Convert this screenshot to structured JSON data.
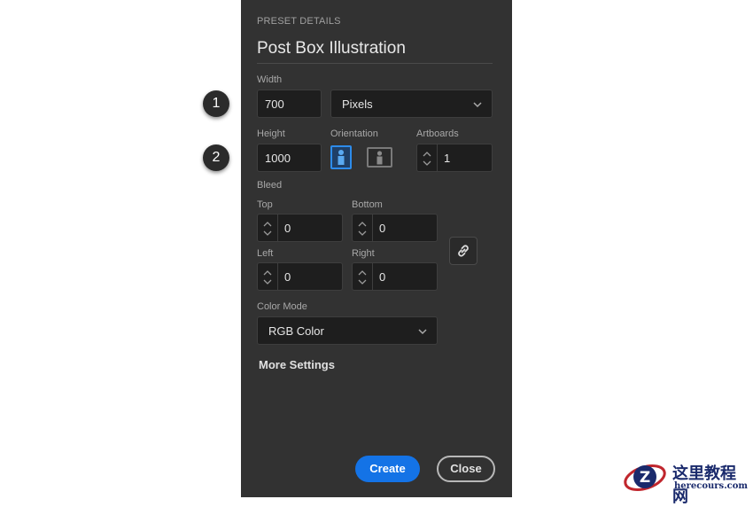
{
  "steps": [
    "1",
    "2"
  ],
  "panel": {
    "section_title": "PRESET DETAILS",
    "preset_name": "Post Box Illustration",
    "width": {
      "label": "Width",
      "value": "700",
      "unit": "Pixels"
    },
    "height": {
      "label": "Height",
      "value": "1000"
    },
    "orientation": {
      "label": "Orientation",
      "selected": "portrait"
    },
    "artboards": {
      "label": "Artboards",
      "value": "1"
    },
    "bleed": {
      "label": "Bleed",
      "top": {
        "label": "Top",
        "value": "0"
      },
      "bottom": {
        "label": "Bottom",
        "value": "0"
      },
      "left": {
        "label": "Left",
        "value": "0"
      },
      "right": {
        "label": "Right",
        "value": "0"
      }
    },
    "color_mode": {
      "label": "Color Mode",
      "value": "RGB Color"
    },
    "more_settings": "More Settings",
    "buttons": {
      "create": "Create",
      "close": "Close"
    }
  },
  "watermark": {
    "title": "这里教程网",
    "url": "herecours.com"
  },
  "colors": {
    "panel_bg": "#323232",
    "accent": "#1473e6"
  }
}
